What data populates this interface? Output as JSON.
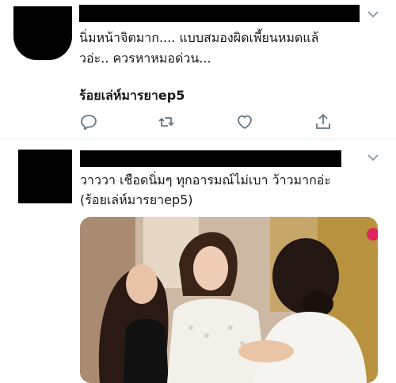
{
  "tweets": [
    {
      "lines": [
        "นิ่มหน้าจิตมาก.... แบบสมองผิดเพี้ยนหมดแล้",
        "วอ่ะ..  ควรหาหมอด่วน..."
      ],
      "hashtag": "ร้อยเล่ห์มารยาep5",
      "actions": [
        "reply-icon",
        "retweet-icon",
        "like-icon",
        "share-icon"
      ]
    },
    {
      "lines": [
        "วาววา เชือดนิ่มๆ ทุกอารมณ์ไม่เบา ว้าวมากอ่ะ",
        "(ร้อยเล่ห์มารยาep5)"
      ],
      "media": "drama-scene-image"
    }
  ],
  "colors": {
    "icon": "#657786",
    "text": "#14171a",
    "divider": "#e6ecf0"
  }
}
